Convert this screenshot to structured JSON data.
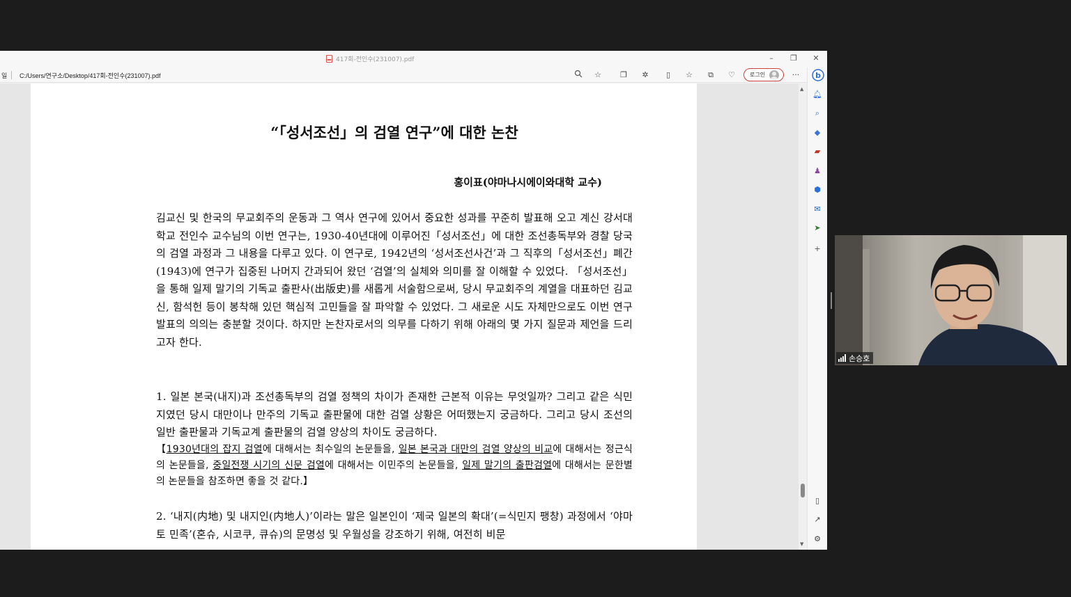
{
  "browser": {
    "tab_title": "417회-전인수(231007).pdf",
    "address_prefix": "일",
    "url": "C:/Users/연구소/Desktop/417회-전인수(231007).pdf",
    "login_label": "로그인",
    "window_controls": {
      "minimize": "–",
      "restore": "❐",
      "close": "✕"
    },
    "more_menu": "···"
  },
  "document": {
    "title": "“「성서조선」의 검열 연구”에 대한 논찬",
    "author": "홍이표(야마나시에이와대학 교수)",
    "intro": "김교신 및 한국의 무교회주의 운동과 그 역사 연구에 있어서 중요한 성과를 꾸준히 발표해 오고 계신 강서대학교 전인수 교수님의 이번 연구는, 1930-40년대에 이루어진「성서조선」에 대한 조선총독부와 경찰 당국의 검열 과정과 그 내용을 다루고 있다. 이 연구로, 1942년의 ‘성서조선사건’과 그 직후의「성서조선」폐간(1943)에 연구가 집중된 나머지 간과되어 왔던 ‘검열’의 실체와 의미를 잘 이해할 수 있었다. 「성서조선」을 통해 일제 말기의 기독교 출판사(出版史)를 새롭게 서술함으로써, 당시 무교회주의 계열을 대표하던 김교신, 함석헌 등이 봉착해 있던 핵심적 고민들을 잘 파악할 수 있었다. 그 새로운 시도 자체만으로도 이번 연구 발표의 의의는 충분할 것이다. 하지만 논찬자로서의 의무를 다하기 위해 아래의 몇 가지 질문과 제언을 드리고자 한다.",
    "q1": "1. 일본 본국(내지)과 조선총독부의 검열 정책의 차이가 존재한 근본적 이유는 무엇일까? 그리고 같은 식민지였던 당시 대만이나 만주의 기독교 출판물에 대한 검열 상황은 어떠했는지 궁금하다. 그리고 당시 조선의 일반 출판물과 기독교계 출판물의 검열 양상의 차이도 궁금하다.",
    "q1_ref": {
      "open": "【",
      "u1": "1930년대의 잡지 검열",
      "t1": "에 대해서는 최수일의 논문들을, ",
      "u2": "일본 본국과 대만의 검열 양상의 비교",
      "t2": "에 대해서는 정근식의 논문들을, ",
      "u3": "중일전쟁 시기의 신문 검열",
      "t3": "에 대해서는 이민주의 논문들을, ",
      "u4": "일제 말기의 출판검열",
      "t4": "에 대해서는 문한별의 논문들을 참조하면 좋을 것 같다.",
      "close": "】"
    },
    "q2": "2. ‘내지(内地) 및 내지인(内地人)’이라는 말은 일본인이 ‘제국 일본의 확대’(=식민지 팽창) 과정에서 ‘야마토 민족’(혼슈, 시코쿠, 큐슈)의 문명성 및 우월성을 강조하기 위해, 여전히 비문"
  },
  "video": {
    "participant_name": "손승호"
  }
}
